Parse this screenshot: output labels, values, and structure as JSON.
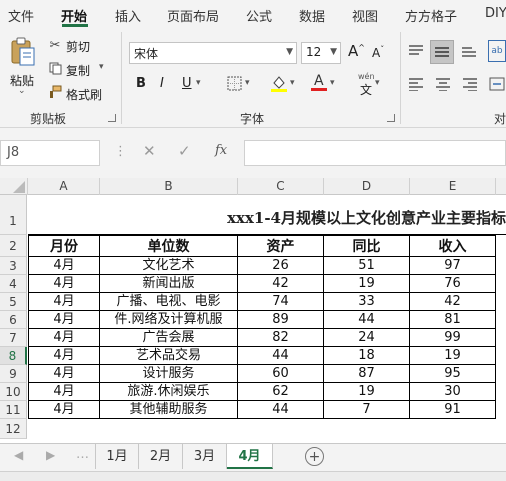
{
  "ribbon_tabs": [
    "文件",
    "开始",
    "插入",
    "页面布局",
    "公式",
    "数据",
    "视图",
    "方方格子",
    "DIY"
  ],
  "active_tab": "开始",
  "clipboard": {
    "paste_label": "粘贴",
    "cut_label": "剪切",
    "copy_label": "复制",
    "format_painter_label": "格式刷",
    "group_label": "剪贴板"
  },
  "font": {
    "name": "宋体",
    "size": "12",
    "bold": "B",
    "italic": "I",
    "underline": "U",
    "group_label": "字体",
    "wen_label": "wén"
  },
  "alignment": {
    "group_label": "对"
  },
  "name_box": "J8",
  "formula_bar": {
    "fx_label": "fx",
    "value": ""
  },
  "columns": [
    "A",
    "B",
    "C",
    "D",
    "E"
  ],
  "rows": [
    "1",
    "2",
    "3",
    "4",
    "5",
    "6",
    "7",
    "8",
    "9",
    "10",
    "11",
    "12"
  ],
  "selected_row": "8",
  "sheet": {
    "title": "xxx1-4月规模以上文化创意产业主要指标",
    "headers": [
      "月份",
      "单位数",
      "资产",
      "同比",
      "收入"
    ],
    "data": [
      [
        "4月",
        "文化艺术",
        "26",
        "51",
        "97"
      ],
      [
        "4月",
        "新闻出版",
        "42",
        "19",
        "76"
      ],
      [
        "4月",
        "广播、电视、电影",
        "74",
        "33",
        "42"
      ],
      [
        "4月",
        "件.网络及计算机服",
        "89",
        "44",
        "81"
      ],
      [
        "4月",
        "广告会展",
        "82",
        "24",
        "99"
      ],
      [
        "4月",
        "艺术品交易",
        "44",
        "18",
        "19"
      ],
      [
        "4月",
        "设计服务",
        "60",
        "87",
        "95"
      ],
      [
        "4月",
        "旅游.休闲娱乐",
        "62",
        "19",
        "30"
      ],
      [
        "4月",
        "其他辅助服务",
        "44",
        "7",
        "91"
      ]
    ]
  },
  "sheet_tabs": [
    "1月",
    "2月",
    "3月",
    "4月"
  ],
  "active_sheet": "4月",
  "colors": {
    "accent": "#217346",
    "highlight": "#ffff00",
    "font_red": "#e02020"
  }
}
